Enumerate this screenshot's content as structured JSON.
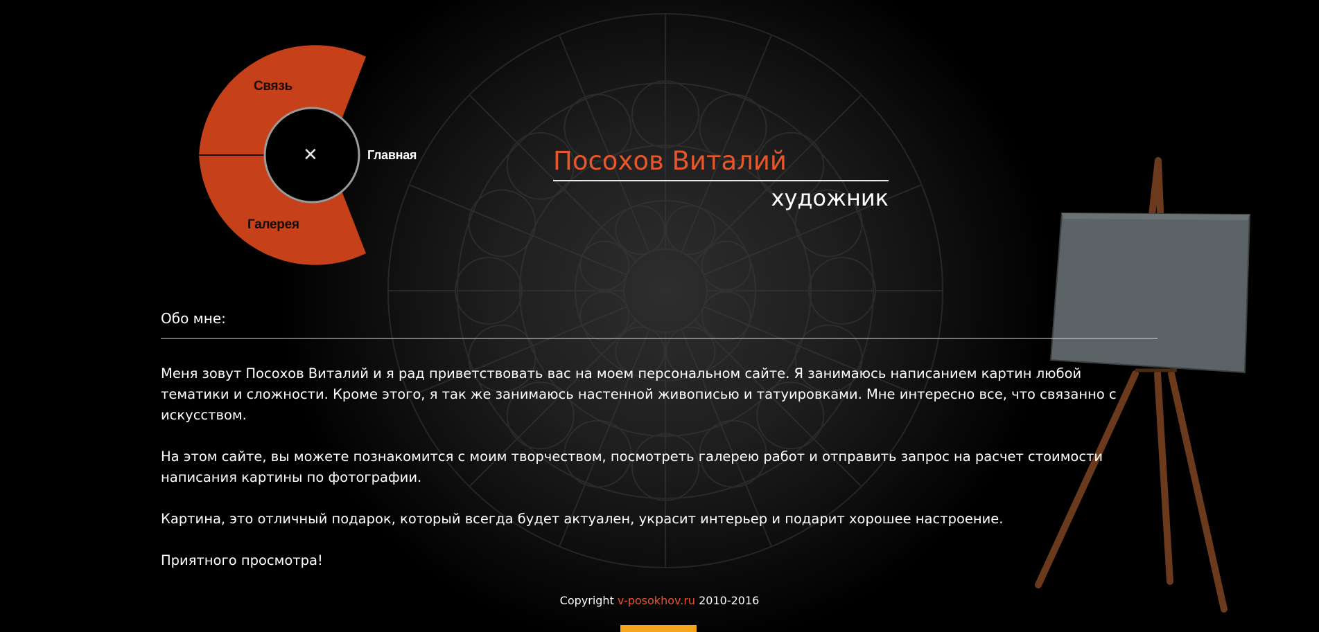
{
  "menu": {
    "items": [
      {
        "label": "Связь"
      },
      {
        "label": "Главная"
      },
      {
        "label": "Галерея"
      }
    ],
    "close_symbol": "✕",
    "accent": "#c6401a"
  },
  "header": {
    "name": "Посохов Виталий",
    "role": "художник"
  },
  "about": {
    "title": "Обо мне:",
    "paragraphs": [
      "Меня зовут Посохов Виталий и я рад приветствовать вас на моем персональном сайте. Я занимаюсь написанием картин любой тематики и сложности. Кроме этого, я так же занимаюсь настенной живописью и татуировками. Мне интересно все, что связанно с искусством.",
      "На этом сайте, вы можете познакомится с моим творчеством, посмотреть галерею работ и отправить запрос на расчет стоимости написания картины по фотографии.",
      "Картина, это отличный подарок, который всегда будет актуален, украсит интерьер и подарит хорошее настроение.",
      "Приятного просмотра!"
    ]
  },
  "footer": {
    "prefix": "Copyright ",
    "link": "v-posokhov.ru",
    "suffix": " 2010-2016"
  },
  "colors": {
    "accent": "#e8572b",
    "background": "#000000",
    "counter": "#f5a51c"
  }
}
